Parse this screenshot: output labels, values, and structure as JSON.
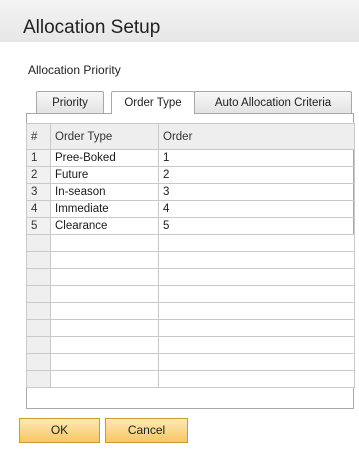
{
  "window": {
    "title": "Allocation Setup"
  },
  "section": {
    "label": "Allocation Priority"
  },
  "tabs": [
    {
      "label": "Priority",
      "active": false
    },
    {
      "label": "Order Type",
      "active": true
    },
    {
      "label": "Auto Allocation Criteria",
      "active": false
    }
  ],
  "table": {
    "columns": [
      "#",
      "Order Type",
      "Order"
    ],
    "rows": [
      {
        "num": "1",
        "type": "Pree-Boked",
        "order": "1"
      },
      {
        "num": "2",
        "type": "Future",
        "order": "2"
      },
      {
        "num": "3",
        "type": "In-season",
        "order": "3"
      },
      {
        "num": "4",
        "type": "Immediate",
        "order": "4"
      },
      {
        "num": "5",
        "type": "Clearance",
        "order": "5"
      }
    ]
  },
  "buttons": {
    "ok": "OK",
    "cancel": "Cancel"
  },
  "colors": {
    "button": "#f6c764",
    "button_border": "#c89a34",
    "header": "#eeeeee"
  }
}
